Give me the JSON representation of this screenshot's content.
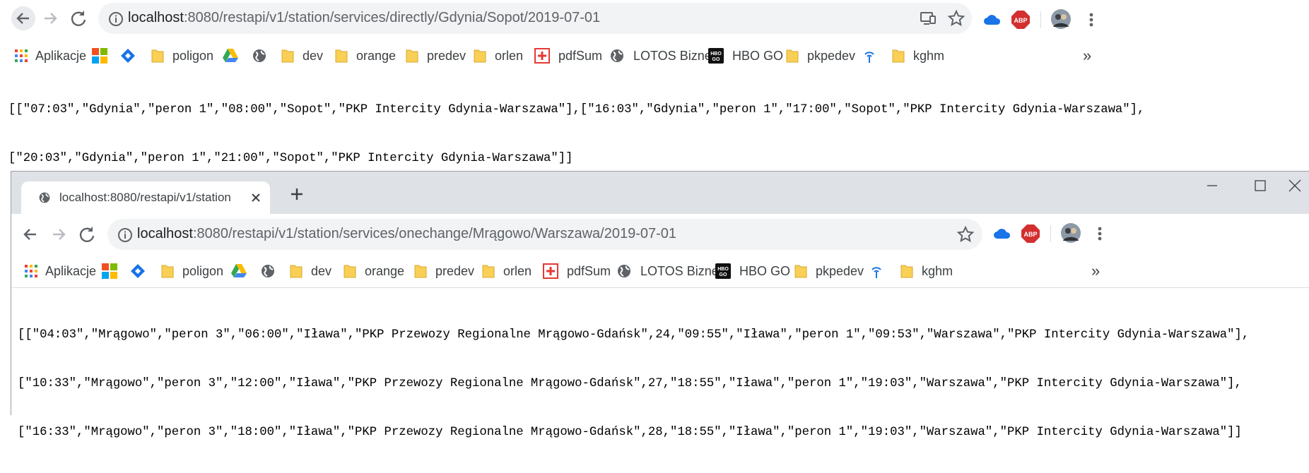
{
  "window1": {
    "address": {
      "host": "localhost",
      "path": ":8080/restapi/v1/station/services/directly/Gdynia/Sopot/2019-07-01"
    },
    "bookmarks": [
      "Aplikacje",
      "poligon",
      "dev",
      "orange",
      "predev",
      "orlen",
      "pdfSum",
      "LOTOS Biznes",
      "HBO GO",
      "pkpedev",
      "kghm"
    ],
    "overflow": "»",
    "body_lines": [
      "[[\"07:03\",\"Gdynia\",\"peron 1\",\"08:00\",\"Sopot\",\"PKP Intercity Gdynia-Warszawa\"],[\"16:03\",\"Gdynia\",\"peron 1\",\"17:00\",\"Sopot\",\"PKP Intercity Gdynia-Warszawa\"],",
      "[\"20:03\",\"Gdynia\",\"peron 1\",\"21:00\",\"Sopot\",\"PKP Intercity Gdynia-Warszawa\"]]"
    ]
  },
  "window2": {
    "tab_title": "localhost:8080/restapi/v1/station",
    "address": {
      "host": "localhost",
      "path": ":8080/restapi/v1/station/services/onechange/Mrągowo/Warszawa/2019-07-01"
    },
    "bookmarks": [
      "Aplikacje",
      "poligon",
      "dev",
      "orange",
      "predev",
      "orlen",
      "pdfSum",
      "LOTOS Biznes",
      "HBO GO",
      "pkpedev",
      "kghm"
    ],
    "overflow": "»",
    "body_lines": [
      "[[\"04:03\",\"Mrągowo\",\"peron 3\",\"06:00\",\"Iława\",\"PKP Przewozy Regionalne Mrągowo-Gdańsk\",24,\"09:55\",\"Iława\",\"peron 1\",\"09:53\",\"Warszawa\",\"PKP Intercity Gdynia-Warszawa\"],",
      "[\"10:33\",\"Mrągowo\",\"peron 3\",\"12:00\",\"Iława\",\"PKP Przewozy Regionalne Mrągowo-Gdańsk\",27,\"18:55\",\"Iława\",\"peron 1\",\"19:03\",\"Warszawa\",\"PKP Intercity Gdynia-Warszawa\"],",
      "[\"16:33\",\"Mrągowo\",\"peron 3\",\"18:00\",\"Iława\",\"PKP Przewozy Regionalne Mrągowo-Gdańsk\",28,\"18:55\",\"Iława\",\"peron 1\",\"19:03\",\"Warszawa\",\"PKP Intercity Gdynia-Warszawa\"]]"
    ]
  },
  "extensions": {
    "abp_label": "ABP",
    "hbo_label": "HBO GO"
  },
  "colors": {
    "accent_blue": "#1a73e8",
    "folder": "#f9cf55",
    "abp_red": "#d32f2f",
    "chrome_frame": "#dee1e6"
  }
}
